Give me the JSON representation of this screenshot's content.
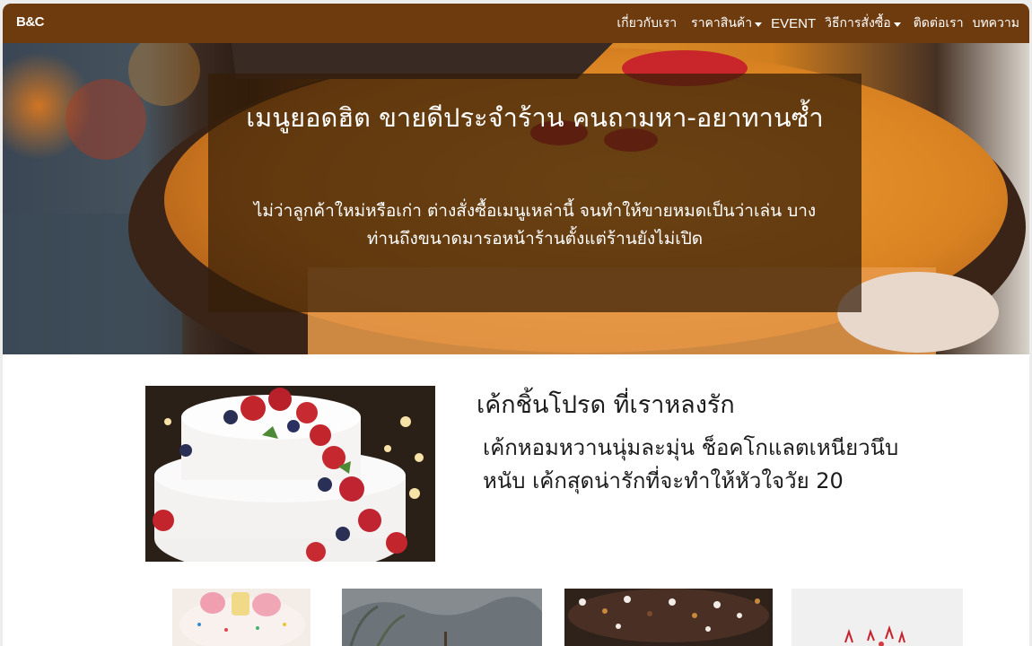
{
  "nav": {
    "brand": "B&C",
    "items": [
      {
        "label": "เกี่ยวกับเรา",
        "dropdown": false
      },
      {
        "label": "ราคาสินค้า",
        "dropdown": true
      },
      {
        "label": "EVENT",
        "dropdown": false
      },
      {
        "label": "วิธีการสั่งซื้อ",
        "dropdown": true
      },
      {
        "label": "ติดต่อเรา",
        "dropdown": false
      },
      {
        "label": "บทความ",
        "dropdown": false
      }
    ]
  },
  "hero": {
    "title": "เมนูยอดฮิต ขายดีประจำร้าน คนถามหา-อยาทานซ้ำ",
    "subtitle": "ไม่ว่าลูกค้าใหม่หรือเก่า ต่างสั่งซื้อเมนูเหล่านี้ จนทำให้ขายหมดเป็นว่าเล่น บางท่านถึงขนาดมารอหน้าร้านตั้งแต่ร้านยังไม่เปิด"
  },
  "feature": {
    "title": "เค้กชิ้นโปรด ที่เราหลงรัก",
    "description": "เค้กหอมหวานนุ่มละมุ่น ช็อคโกแลตเหนียวนึบหนับ เค้กสุดน่ารักที่จะทำให้หัวใจวัย 20"
  },
  "colors": {
    "navbar": "#6e3b0e",
    "hero_overlay": "#341d07",
    "text_dark": "#1c1c1c"
  }
}
